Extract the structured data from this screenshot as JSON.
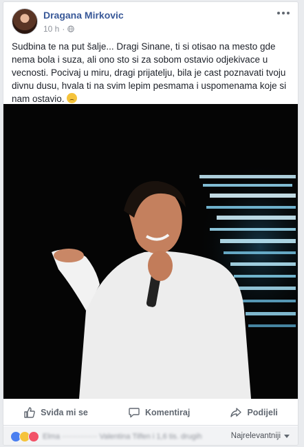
{
  "post": {
    "author": "Dragana Mirkovic",
    "time": "10 h",
    "separator": "·",
    "text": "Sudbina te na put šalje... Dragi Sinane, ti si otisao na mesto gde nema bola i suza, ali ono sto si za sobom ostavio odjekivace u vecnosti. Pocivaj u miru, dragi prijatelju, bila je cast poznavati tvoju divnu dusu, hvala ti na svim lepim pesmama i uspomenama koje si nam ostavio.",
    "emoji_end": "♥"
  },
  "actions": {
    "like": "Sviđa mi se",
    "comment": "Komentiraj",
    "share": "Podijeli"
  },
  "footer": {
    "reactions_summary": "Elma ·············· Valentina Tilfen i 1,6 tis. drugih",
    "sort_label": "Najrelevantniji"
  },
  "icons": {
    "more": "more-options-icon",
    "privacy": "globe-icon",
    "like": "thumbs-up-icon",
    "comment": "comment-icon",
    "share": "share-icon"
  },
  "colors": {
    "author": "#385898",
    "like_reaction": "#4a7ff0",
    "sad_reaction": "#f5c33b",
    "love_reaction": "#f25268"
  }
}
